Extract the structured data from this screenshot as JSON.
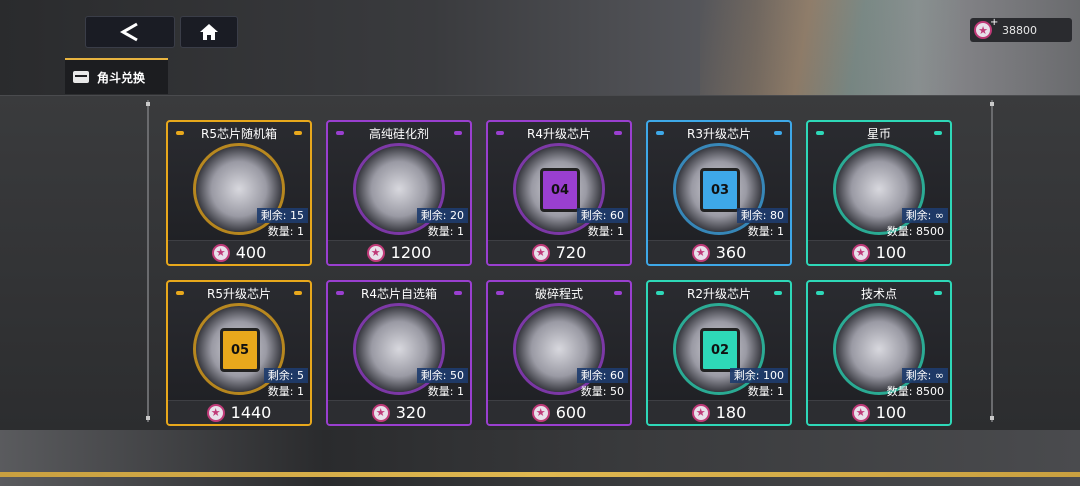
{
  "header": {
    "tab_label": "角斗兑换",
    "currency_value": "38800",
    "back_icon": "back-arrow-icon",
    "home_icon": "home-icon",
    "currency_icon": "star-token-icon"
  },
  "colors": {
    "gold": "#e8a81c",
    "purple": "#9a3fd0",
    "blue": "#3ea8e8",
    "teal": "#2ed8b8",
    "accent_strip": "#e0b850",
    "token_pink": "#c03a78"
  },
  "items": [
    {
      "name": "R5芯片随机箱",
      "remaining": "剩余: 15",
      "quantity": "数量: 1",
      "price": "400",
      "rarity": "gold"
    },
    {
      "name": "高纯硅化剂",
      "remaining": "剩余: 20",
      "quantity": "数量: 1",
      "price": "1200",
      "rarity": "purple"
    },
    {
      "name": "R4升级芯片",
      "remaining": "剩余: 60",
      "quantity": "数量: 1",
      "price": "720",
      "rarity": "purple",
      "chip": "04"
    },
    {
      "name": "R3升级芯片",
      "remaining": "剩余: 80",
      "quantity": "数量: 1",
      "price": "360",
      "rarity": "blue",
      "chip": "03"
    },
    {
      "name": "星币",
      "remaining": "剩余: ∞",
      "quantity": "数量: 8500",
      "price": "100",
      "rarity": "teal"
    },
    {
      "name": "R5升级芯片",
      "remaining": "剩余: 5",
      "quantity": "数量: 1",
      "price": "1440",
      "rarity": "gold",
      "chip": "05"
    },
    {
      "name": "R4芯片自选箱",
      "remaining": "剩余: 50",
      "quantity": "数量: 1",
      "price": "320",
      "rarity": "purple"
    },
    {
      "name": "破碎程式",
      "remaining": "剩余: 60",
      "quantity": "数量: 50",
      "price": "600",
      "rarity": "purple"
    },
    {
      "name": "R2升级芯片",
      "remaining": "剩余: 100",
      "quantity": "数量: 1",
      "price": "180",
      "rarity": "teal",
      "chip": "02"
    },
    {
      "name": "技术点",
      "remaining": "剩余: ∞",
      "quantity": "数量: 8500",
      "price": "100",
      "rarity": "teal"
    }
  ]
}
